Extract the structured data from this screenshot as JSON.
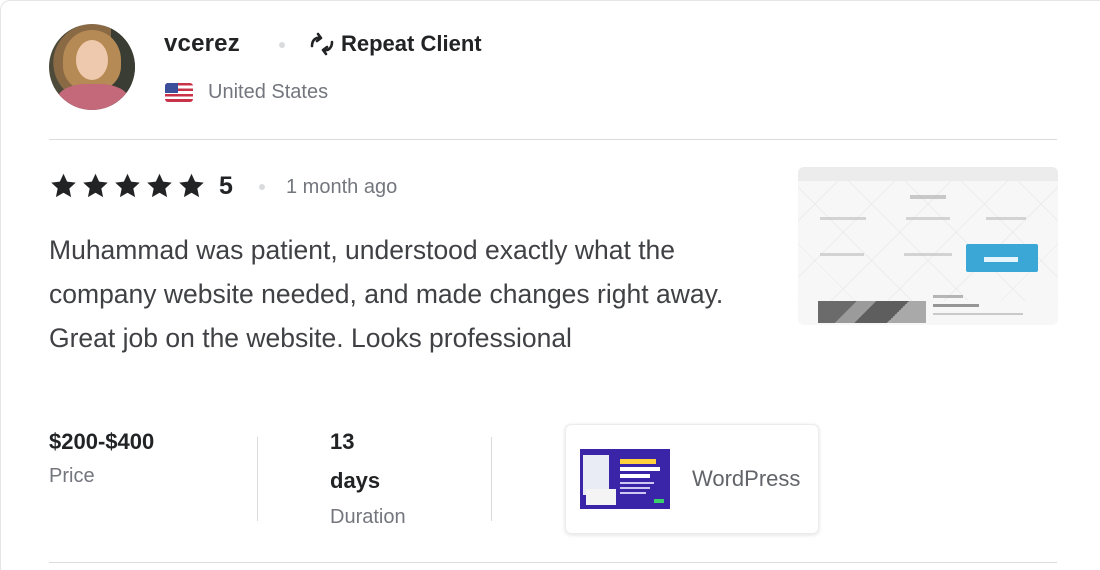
{
  "reviewer": {
    "username": "vcerez",
    "badge_label": "Repeat Client",
    "badge_icon": "repeat-icon",
    "country": "United States",
    "flag": "us-flag-icon"
  },
  "review": {
    "rating": "5",
    "star_count": 5,
    "time_ago": "1 month ago",
    "text": "Muhammad was patient, understood exactly what the company website needed, and made changes right away. Great job on the website. Looks professional"
  },
  "meta": {
    "price": {
      "value": "$200-$400",
      "label": "Price"
    },
    "duration": {
      "value_line1": "13",
      "value_line2": "days",
      "label": "Duration"
    }
  },
  "gig": {
    "title": "WordPress"
  },
  "colors": {
    "text_primary": "#222325",
    "text_secondary": "#74767e",
    "divider": "#dadbdd",
    "star": "#222325"
  }
}
